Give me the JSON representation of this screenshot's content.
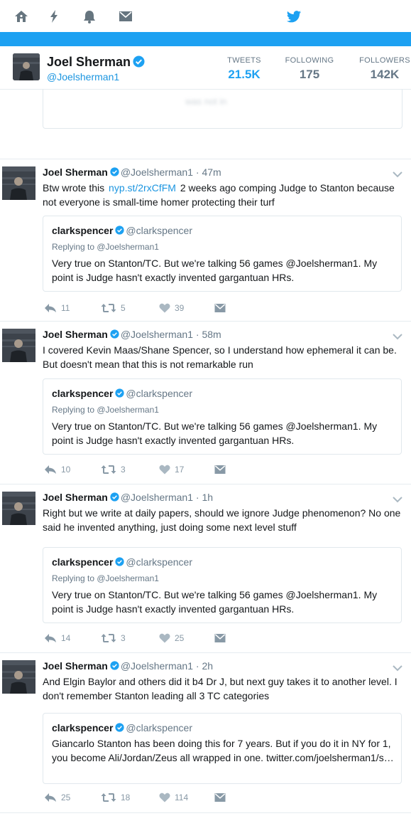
{
  "profile": {
    "name": "Joel Sherman",
    "handle": "@Joelsherman1",
    "stats": [
      {
        "label": "TWEETS",
        "value": "21.5K"
      },
      {
        "label": "FOLLOWING",
        "value": "175"
      },
      {
        "label": "FOLLOWERS",
        "value": "142K"
      }
    ]
  },
  "partial_tweet": {
    "text": "was not in"
  },
  "tweets": [
    {
      "name": "Joel Sherman",
      "handle": "@Joelsherman1",
      "dot": "·",
      "time": "47m",
      "text_before": "Btw wrote this",
      "link": "nyp.st/2rxCfFM",
      "text_after": "2 weeks ago comping Judge to Stanton because not everyone is small-time homer protecting their turf",
      "quote": {
        "name": "clarkspencer",
        "handle": "@clarkspencer",
        "reply": "Replying to @Joelsherman1",
        "text": "Very true on Stanton/TC. But we're talking 56 games @Joelsherman1. My point is Judge hasn't exactly invented gargantuan HRs."
      },
      "replies": "11",
      "retweets": "5",
      "likes": "39"
    },
    {
      "name": "Joel Sherman",
      "handle": "@Joelsherman1",
      "dot": "·",
      "time": "58m",
      "text": "I covered Kevin Maas/Shane Spencer, so I understand how ephemeral it can be. But doesn't mean that this is not remarkable run",
      "quote": {
        "name": "clarkspencer",
        "handle": "@clarkspencer",
        "reply": "Replying to @Joelsherman1",
        "text": "Very true on Stanton/TC. But we're talking 56 games @Joelsherman1. My point is Judge hasn't exactly invented gargantuan HRs."
      },
      "replies": "10",
      "retweets": "3",
      "likes": "17"
    },
    {
      "name": "Joel Sherman",
      "handle": "@Joelsherman1",
      "dot": "·",
      "time": "1h",
      "text": "Right but we write at daily papers, should we ignore Judge phenomenon? No one said he invented anything, just doing some next level stuff",
      "quote": {
        "name": "clarkspencer",
        "handle": "@clarkspencer",
        "reply": "Replying to @Joelsherman1",
        "text": "Very true on Stanton/TC. But we're talking 56 games @Joelsherman1. My point is Judge hasn't exactly invented gargantuan HRs."
      },
      "replies": "14",
      "retweets": "3",
      "likes": "25"
    },
    {
      "name": "Joel Sherman",
      "handle": "@Joelsherman1",
      "dot": "·",
      "time": "2h",
      "text": "And Elgin Baylor and others did it b4 Dr J, but next guy takes it to another level. I don't remember Stanton leading all 3 TC categories",
      "quote": {
        "name": "clarkspencer",
        "handle": "@clarkspencer",
        "text": "Giancarlo Stanton has been doing this for 7 years. But if you do it in NY for 1, you become Ali/Jordan/Zeus all wrapped in one. twitter.com/joelsherman1/s…"
      },
      "replies": "25",
      "retweets": "18",
      "likes": "114"
    }
  ],
  "icons": {
    "nav": [
      "home-icon",
      "moments-icon",
      "notifications-icon",
      "messages-icon",
      "twitter-bird-icon"
    ],
    "actions": [
      "reply-icon",
      "retweet-icon",
      "like-icon",
      "direct-message-icon"
    ]
  },
  "colors": {
    "brand": "#1da1f2",
    "link": "#1b95e0",
    "muted": "#657786",
    "icon": "#8899a6",
    "nav_icon": "#66757f"
  }
}
